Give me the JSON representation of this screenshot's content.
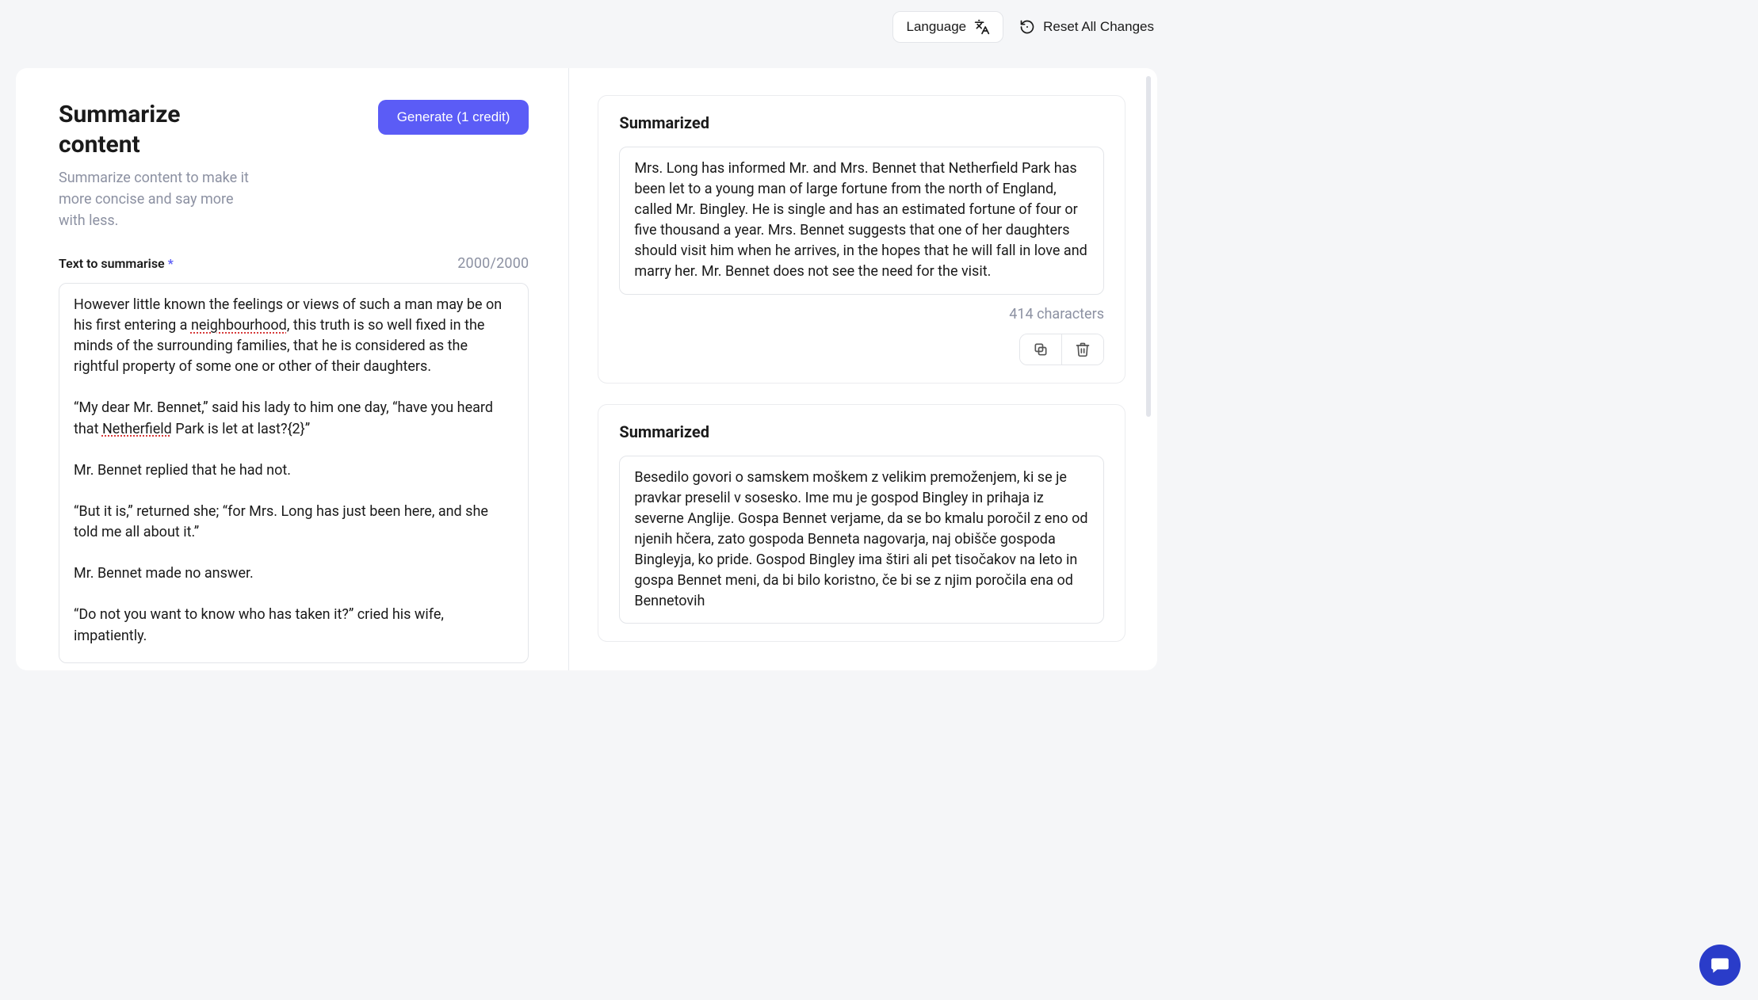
{
  "topbar": {
    "language_label": "Language",
    "reset_label": "Reset All Changes"
  },
  "left": {
    "title": "Summarize content",
    "subtitle": "Summarize content to make it more concise and say more with less.",
    "generate_label": "Generate (1 credit)",
    "input_label": "Text to summarise",
    "char_count": "2000/2000",
    "text_parts": {
      "p1a": "However little known the feelings or views of such a man may be on his first entering a ",
      "p1_spell": "neighbourhood",
      "p1b": ", this truth is so well fixed in the minds of the surrounding families, that he is considered as the rightful property of some one or other of their daughters.",
      "p2a": "“My dear Mr. Bennet,” said his lady to him one day, “have you heard that ",
      "p2_spell": "Netherfield",
      "p2b": " Park is let at last?{2}”",
      "p3": "Mr. Bennet replied that he had not.",
      "p4": "“But it is,” returned she; “for Mrs. Long has just been here, and she told me all about it.”",
      "p5": "Mr. Bennet made no answer.",
      "p6": "“Do not you want to know who has taken it?” cried his wife, impatiently."
    }
  },
  "results": [
    {
      "title": "Summarized",
      "text": "Mrs. Long has informed Mr. and Mrs. Bennet that Netherfield Park has been let to a young man of large fortune from the north of England, called Mr. Bingley. He is single and has an estimated fortune of four or five thousand a year. Mrs. Bennet suggests that one of her daughters should visit him when he arrives, in the hopes that he will fall in love and marry her. Mr. Bennet does not see the need for the visit.",
      "meta": "414 characters"
    },
    {
      "title": "Summarized",
      "text": "Besedilo govori o samskem moškem z velikim premoženjem, ki se je pravkar preselil v sosesko. Ime mu je gospod Bingley in prihaja iz severne Anglije. Gospa Bennet verjame, da se bo kmalu poročil z eno od njenih hčera, zato gospoda Benneta nagovarja, naj obišče gospoda Bingleyja, ko pride. Gospod Bingley ima štiri ali pet tisočakov na leto in gospa Bennet meni, da bi bilo koristno, če bi se z njim poročila ena od Bennetovih",
      "meta": ""
    }
  ],
  "icons": {
    "language": "translate-icon",
    "reset": "history-icon",
    "copy": "copy-icon",
    "trash": "trash-icon",
    "chat": "chat-icon"
  }
}
